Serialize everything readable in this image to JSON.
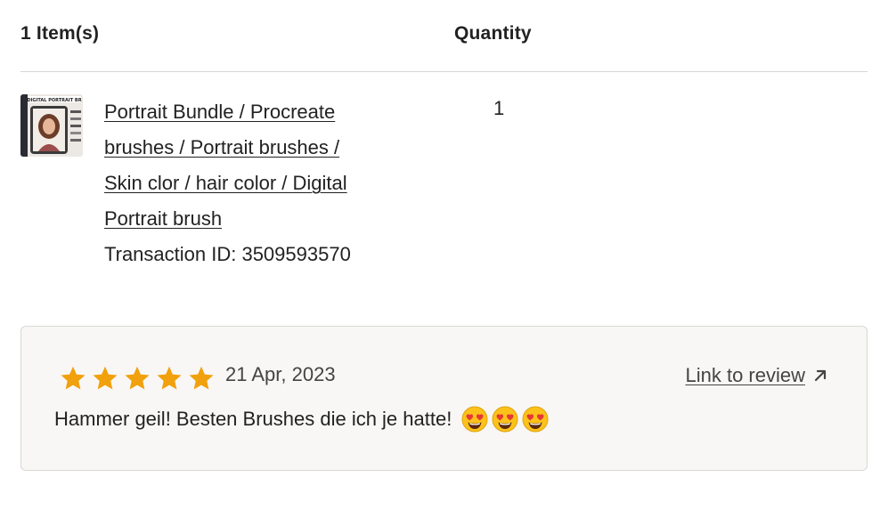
{
  "header": {
    "items_count": "1 Item(s)",
    "quantity_label": "Quantity"
  },
  "item": {
    "title_lines": [
      "Portrait Bundle / Procreate",
      "brushes / Portrait brushes /",
      "Skin clor / hair color / Digital",
      "Portrait brush"
    ],
    "transaction": "Transaction ID: 3509593570",
    "quantity": "1",
    "thumbnail_text": "DIGITAL PORTRAIT BR"
  },
  "review": {
    "rating": 5,
    "rating_max": 5,
    "star_color": "#f1a10d",
    "date": "21 Apr, 2023",
    "link_label": "Link to review",
    "link_icon": "arrow-up-right-icon",
    "text": "Hammer geil! Besten Brushes die ich je hatte!",
    "emoji_icon": "heart-eyes-emoji-icon",
    "emoji_count": 3
  }
}
